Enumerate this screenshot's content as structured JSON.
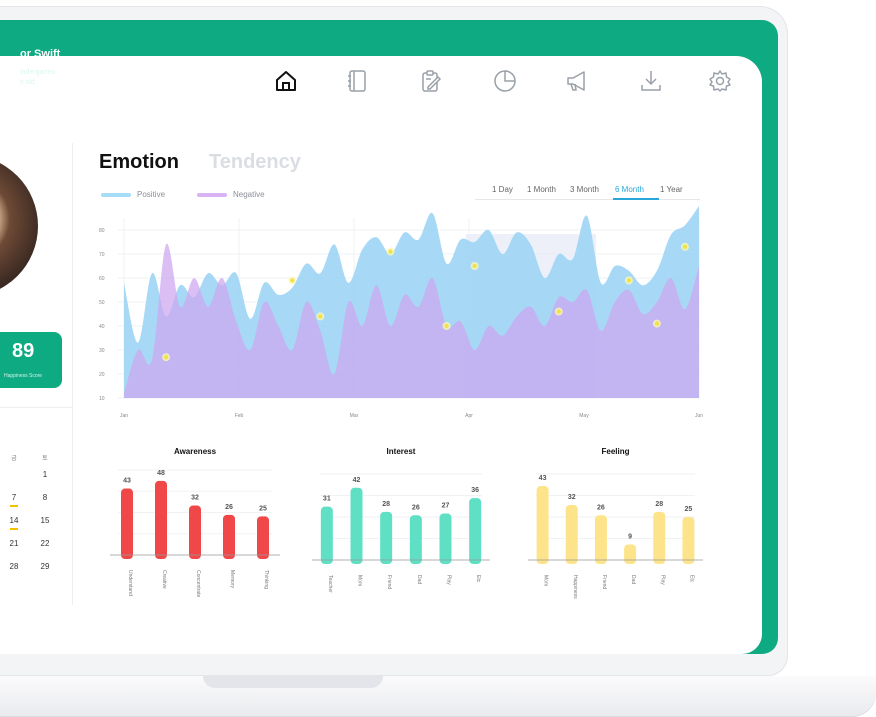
{
  "profile": {
    "name": "or Swift",
    "line1": "indergarten",
    "line2": "s old"
  },
  "nav": {
    "items": [
      {
        "icon": "home-icon",
        "active": true
      },
      {
        "icon": "notebook-icon",
        "active": false
      },
      {
        "icon": "clipboard-edit-icon",
        "active": false
      },
      {
        "icon": "pie-chart-icon",
        "active": false
      },
      {
        "icon": "megaphone-icon",
        "active": false
      },
      {
        "icon": "download-icon",
        "active": false
      },
      {
        "icon": "settings-icon",
        "active": false
      }
    ]
  },
  "score": {
    "value": "89",
    "label": "Happiness Score"
  },
  "calendar": {
    "headers": [
      "금",
      "토"
    ],
    "rows": [
      [
        "",
        "1"
      ],
      [
        "7",
        "8"
      ],
      [
        "14",
        "15"
      ],
      [
        "21",
        "22"
      ],
      [
        "28",
        "29"
      ]
    ],
    "marked": [
      "7",
      "14"
    ]
  },
  "emotion": {
    "tab_active": "Emotion",
    "tab_inactive": "Tendency",
    "legend": {
      "positive": "Positive",
      "negative": "Negative"
    },
    "ranges": [
      "1 Day",
      "1 Month",
      "3 Month",
      "6 Month",
      "1 Year"
    ],
    "active_range": "6 Month"
  },
  "colors": {
    "brand": "#0eaa82",
    "positive": "#9fd6f5",
    "negative": "#cda6f0",
    "overlap": "#a9a6f2",
    "awareness": "#f04848",
    "interest": "#5fe0c4",
    "feeling": "#fde48a",
    "accent": "#2aa7d9"
  },
  "chart_data": [
    {
      "type": "area",
      "title": "",
      "y_ticks": [
        10,
        20,
        30,
        40,
        50,
        60,
        70,
        80
      ],
      "ylim": [
        10,
        85
      ],
      "x_ticks": [
        "Jan",
        "Feb",
        "Mar",
        "Apr",
        "May",
        "Jun"
      ],
      "grid": true,
      "legend": "top-left",
      "series": [
        {
          "name": "Positive",
          "values": [
            58,
            33,
            62,
            44,
            57,
            52,
            62,
            57,
            62,
            43,
            58,
            53,
            56,
            66,
            62,
            74,
            58,
            72,
            77,
            70,
            79,
            76,
            87,
            66,
            76,
            75,
            80,
            70,
            79,
            74,
            60,
            70,
            68,
            86,
            58,
            65,
            63,
            57,
            63,
            78,
            82,
            90
          ]
        },
        {
          "name": "Negative",
          "values": [
            12,
            30,
            26,
            74,
            48,
            60,
            48,
            60,
            42,
            30,
            50,
            40,
            30,
            50,
            38,
            20,
            50,
            40,
            57,
            40,
            53,
            48,
            60,
            40,
            42,
            30,
            40,
            36,
            44,
            48,
            40,
            52,
            50,
            55,
            38,
            50,
            55,
            45,
            50,
            60,
            47,
            65
          ]
        }
      ],
      "highlight_points": [
        {
          "series": "Negative",
          "index": 3,
          "value": 27
        },
        {
          "series": "Positive",
          "index": 12,
          "value": 59
        },
        {
          "series": "Negative",
          "index": 14,
          "value": 44
        },
        {
          "series": "Positive",
          "index": 19,
          "value": 71
        },
        {
          "series": "Negative",
          "index": 23,
          "value": 40
        },
        {
          "series": "Positive",
          "index": 25,
          "value": 65
        },
        {
          "series": "Negative",
          "index": 31,
          "value": 46
        },
        {
          "series": "Positive",
          "index": 36,
          "value": 59
        },
        {
          "series": "Negative",
          "index": 38,
          "value": 41
        },
        {
          "series": "Positive",
          "index": 40,
          "value": 73
        }
      ]
    },
    {
      "type": "bar",
      "title": "Awareness",
      "categories": [
        "Understand",
        "Creative",
        "Concentrate",
        "Memory",
        "Thinking"
      ],
      "values": [
        43,
        48,
        32,
        26,
        25
      ],
      "ylim": [
        0,
        55
      ]
    },
    {
      "type": "bar",
      "title": "Interest",
      "categories": [
        "Teacher",
        "Mom",
        "Friend",
        "Dad",
        "Play",
        "Etc"
      ],
      "values": [
        31,
        42,
        28,
        26,
        27,
        36
      ],
      "ylim": [
        0,
        50
      ]
    },
    {
      "type": "bar",
      "title": "Feeling",
      "categories": [
        "Mom",
        "Happiness",
        "Friend",
        "Dad",
        "Play",
        "Etc"
      ],
      "values": [
        43,
        32,
        26,
        9,
        28,
        25
      ],
      "ylim": [
        0,
        50
      ]
    }
  ]
}
